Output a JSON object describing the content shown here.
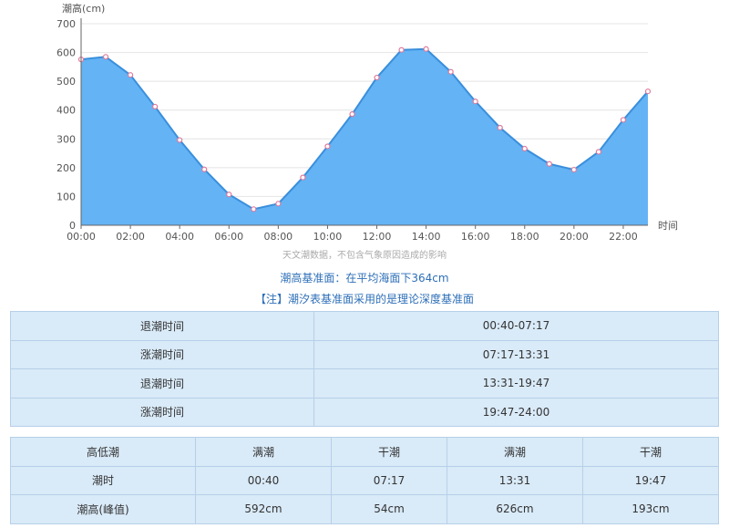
{
  "chart_data": {
    "type": "area",
    "ylabel": "潮高(cm)",
    "xlabel": "时间",
    "ylim": [
      0,
      700
    ],
    "yticks": [
      "0",
      "100",
      "200",
      "300",
      "400",
      "500",
      "600",
      "700"
    ],
    "xticks": [
      "00:00",
      "02:00",
      "04:00",
      "06:00",
      "08:00",
      "10:00",
      "12:00",
      "14:00",
      "16:00",
      "18:00",
      "20:00",
      "22:00"
    ],
    "x": [
      0,
      1,
      2,
      3,
      4,
      5,
      6,
      7,
      8,
      9,
      10,
      11,
      12,
      13,
      14,
      15,
      16,
      17,
      18,
      19,
      20,
      21,
      22,
      23
    ],
    "values": [
      576,
      585,
      522,
      412,
      296,
      194,
      107,
      56,
      75,
      166,
      274,
      386,
      513,
      609,
      612,
      533,
      430,
      339,
      266,
      213,
      193,
      255,
      366,
      465
    ],
    "colors": {
      "fill": "#63b3f5",
      "line": "#3a8fdc",
      "marker": "#e07a9a",
      "grid": "#e4e4e4"
    }
  },
  "notes": {
    "source": "天文潮数据，不包含气象原因造成的影响",
    "datum": "潮高基准面：在平均海面下364cm",
    "theory": "【注】潮汐表基准面采用的是理论深度基准面"
  },
  "periods": [
    {
      "label": "退潮时间",
      "value": "00:40-07:17"
    },
    {
      "label": "涨潮时间",
      "value": "07:17-13:31"
    },
    {
      "label": "退潮时间",
      "value": "13:31-19:47"
    },
    {
      "label": "涨潮时间",
      "value": "19:47-24:00"
    }
  ],
  "extremes": {
    "header": [
      "高低潮",
      "满潮",
      "干潮",
      "满潮",
      "干潮"
    ],
    "times": [
      "潮时",
      "00:40",
      "07:17",
      "13:31",
      "19:47"
    ],
    "heights": [
      "潮高(峰值)",
      "592cm",
      "54cm",
      "626cm",
      "193cm"
    ]
  }
}
